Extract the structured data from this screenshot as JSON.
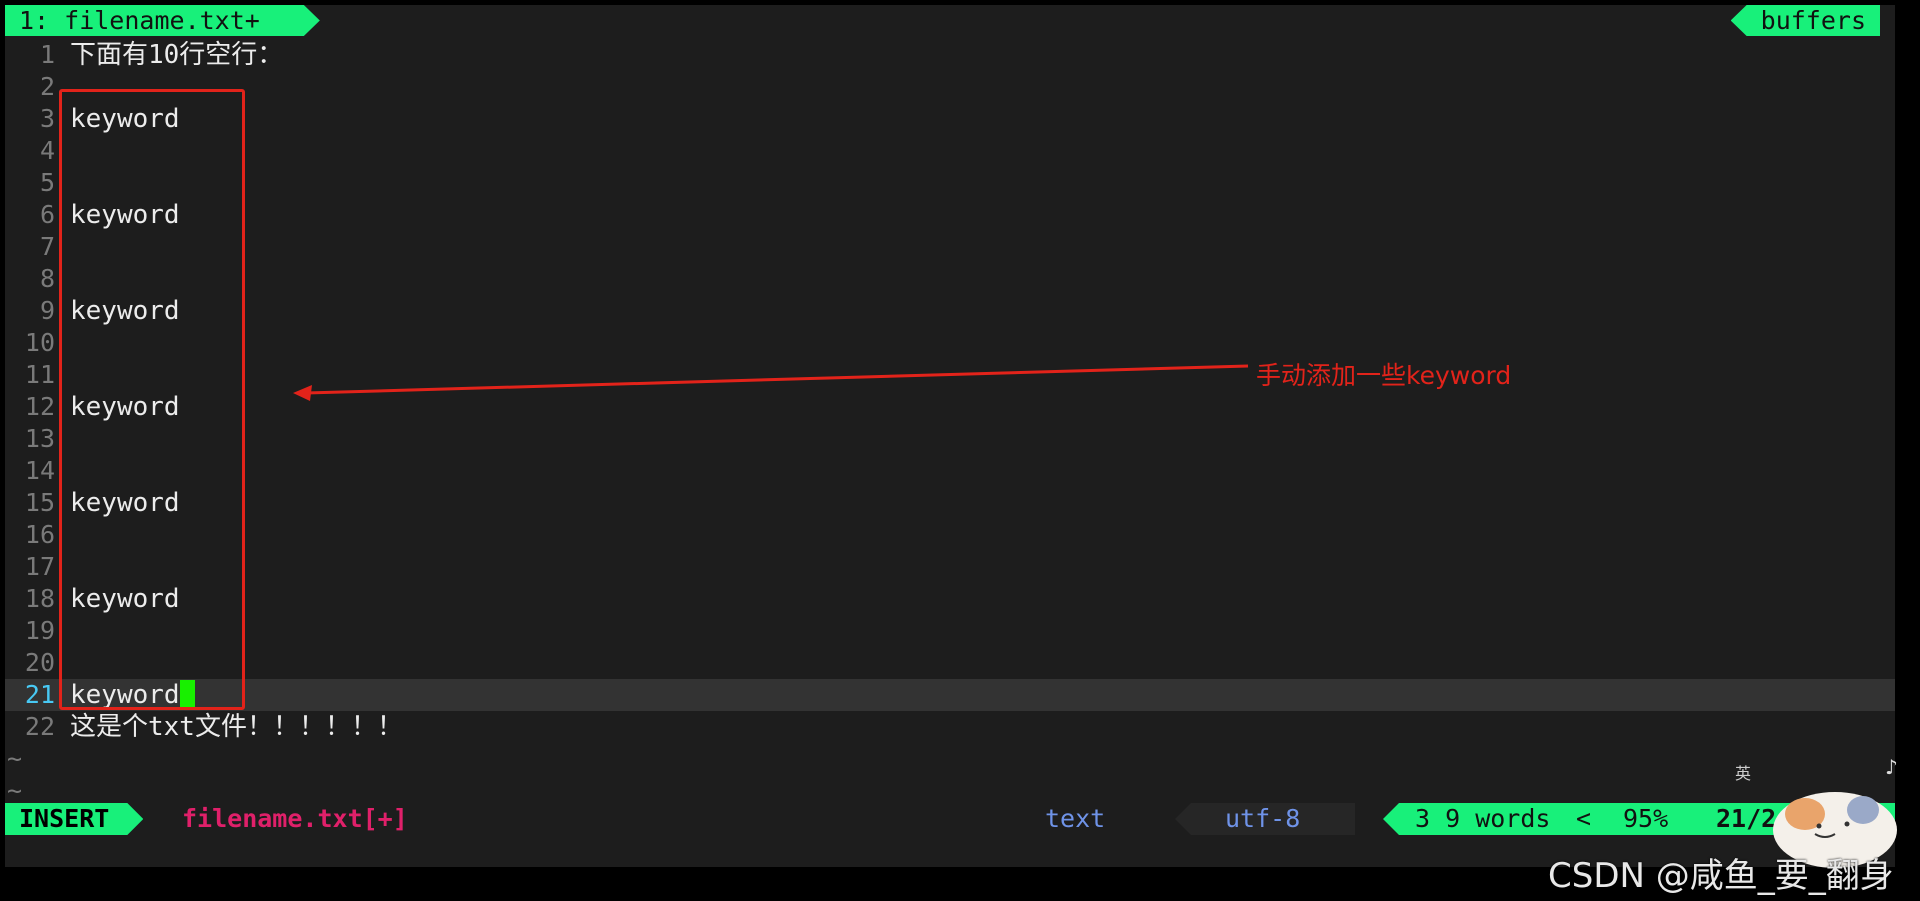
{
  "tabline": {
    "active_tab": "1: filename.txt+",
    "buffers_label": "buffers"
  },
  "editor": {
    "lines": [
      {
        "num": "1",
        "text": "下面有10行空行："
      },
      {
        "num": "2",
        "text": ""
      },
      {
        "num": "3",
        "text": "keyword"
      },
      {
        "num": "4",
        "text": ""
      },
      {
        "num": "5",
        "text": ""
      },
      {
        "num": "6",
        "text": "keyword"
      },
      {
        "num": "7",
        "text": ""
      },
      {
        "num": "8",
        "text": ""
      },
      {
        "num": "9",
        "text": "keyword"
      },
      {
        "num": "10",
        "text": ""
      },
      {
        "num": "11",
        "text": ""
      },
      {
        "num": "12",
        "text": "keyword"
      },
      {
        "num": "13",
        "text": ""
      },
      {
        "num": "14",
        "text": ""
      },
      {
        "num": "15",
        "text": "keyword"
      },
      {
        "num": "16",
        "text": ""
      },
      {
        "num": "17",
        "text": ""
      },
      {
        "num": "18",
        "text": "keyword"
      },
      {
        "num": "19",
        "text": ""
      },
      {
        "num": "20",
        "text": ""
      },
      {
        "num": "21",
        "text": "keyword"
      },
      {
        "num": "22",
        "text": "这是个txt文件！！！！！！"
      }
    ],
    "current_line": "21",
    "tilde": "~"
  },
  "statusline": {
    "mode": "INSERT",
    "filename": "filename.txt[+]",
    "filetype": "text",
    "encoding": "utf-8",
    "word_count": "3 9 words",
    "separator": "<",
    "percent": "95%",
    "position": "21/2"
  },
  "annotation": {
    "text": "手动添加一些keyword",
    "color": "#e2231a"
  },
  "watermark": {
    "text": "CSDN @咸鱼_要_翻身",
    "ime_label": "英"
  },
  "colors": {
    "accent_green": "#18f07a",
    "background": "#1d1d1d",
    "filename_pink": "#e0206a",
    "info_blue": "#6f93e8"
  }
}
